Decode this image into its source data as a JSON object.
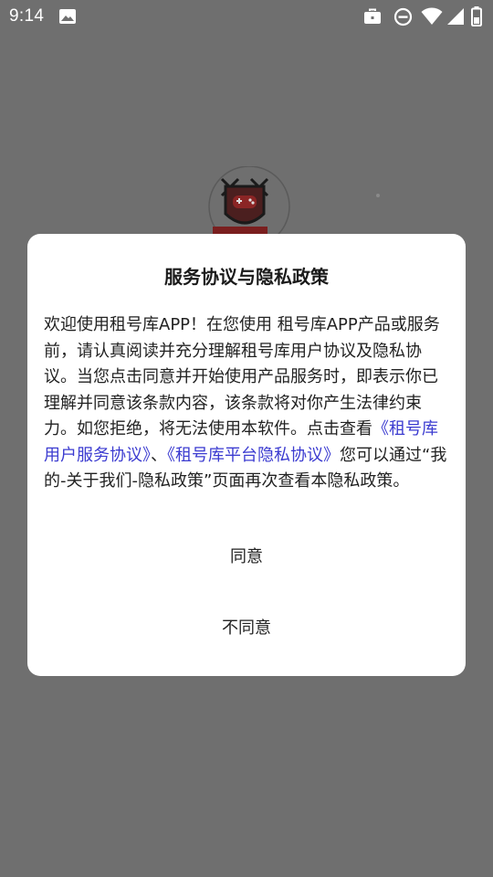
{
  "status_bar": {
    "time": "9:14",
    "icons": [
      "image-icon",
      "briefcase-icon",
      "do-not-disturb-icon",
      "wifi-icon",
      "battery-icon"
    ]
  },
  "splash": {
    "logo_icon": "game-controller-shield-logo"
  },
  "dialog": {
    "title": "服务协议与隐私政策",
    "body": {
      "intro": "欢迎使用租号库APP！在您使用 租号库APP产品或服务前，请认真阅读并充分理解租号库用户协议及隐私协议。当您点击同意并开始使用产品服务时，即表示你已理解并同意该条款内容，该条款将对你产生法律约束力。如您拒绝，将无法使用本软件。点击查看",
      "link_user_agreement": "《租号库用户服务协议》",
      "separator": "、",
      "link_privacy_agreement": "《租号库平台隐私协议》",
      "outro": "您可以通过“我的-关于我们-隐私政策”页面再次查看本隐私政策。"
    },
    "agree_label": "同意",
    "disagree_label": "不同意"
  },
  "colors": {
    "scrim": "#6f6f6f",
    "dialog_background": "#ffffff",
    "link": "#3b3bd0",
    "text": "#222222"
  }
}
